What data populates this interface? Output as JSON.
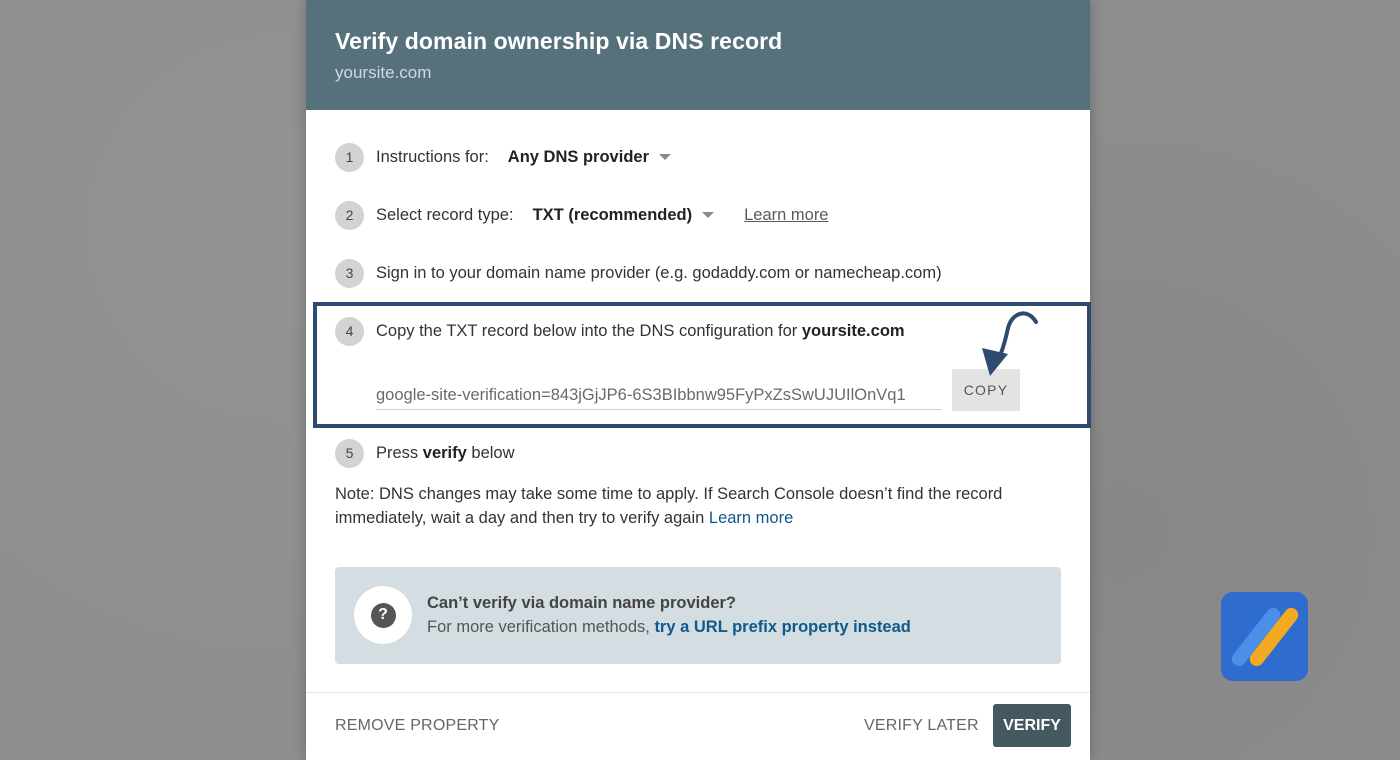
{
  "dialog": {
    "title": "Verify domain ownership via DNS record",
    "subtitle": "yoursite.com"
  },
  "steps": [
    {
      "num": "1",
      "label": "Instructions for:",
      "value": "Any DNS provider"
    },
    {
      "num": "2",
      "label": "Select record type:",
      "value": "TXT (recommended)",
      "link": "Learn more"
    },
    {
      "num": "3",
      "label": "Sign in to your domain name provider (e.g. godaddy.com or namecheap.com)"
    },
    {
      "num": "4",
      "label": "Copy the TXT record below into the DNS configuration for",
      "bold": "yoursite.com"
    },
    {
      "num": "5",
      "label_prefix": "Press",
      "bold": "verify",
      "label_suffix": "below"
    }
  ],
  "txt_record": {
    "value": "google-site-verification=843jGjJP6-6S3BIbbnw95FyPxZsSwUJUIlOnVq1",
    "copy_label": "COPY"
  },
  "note": {
    "text": "Note: DNS changes may take some time to apply. If Search Console doesn’t find the record immediately, wait a day and then try to verify again",
    "link": "Learn more"
  },
  "info_box": {
    "title": "Can’t verify via domain name provider?",
    "text": "For more verification methods,",
    "link": "try a URL prefix property instead"
  },
  "footer": {
    "remove_label": "REMOVE PROPERTY",
    "later_label": "VERIFY LATER",
    "verify_label": "VERIFY"
  },
  "colors": {
    "header": "#56717c",
    "highlight_border": "#2e4a6e",
    "link_blue": "#0d5a8c",
    "verify_button": "#44585f",
    "logo_blue": "#2e6ccf",
    "logo_orange": "#f4a922"
  },
  "icons": {
    "help": "question-mark-circle-icon",
    "arrow": "curved-arrow-icon",
    "dropdown": "caret-down-icon",
    "logo": "app-logo-icon"
  }
}
